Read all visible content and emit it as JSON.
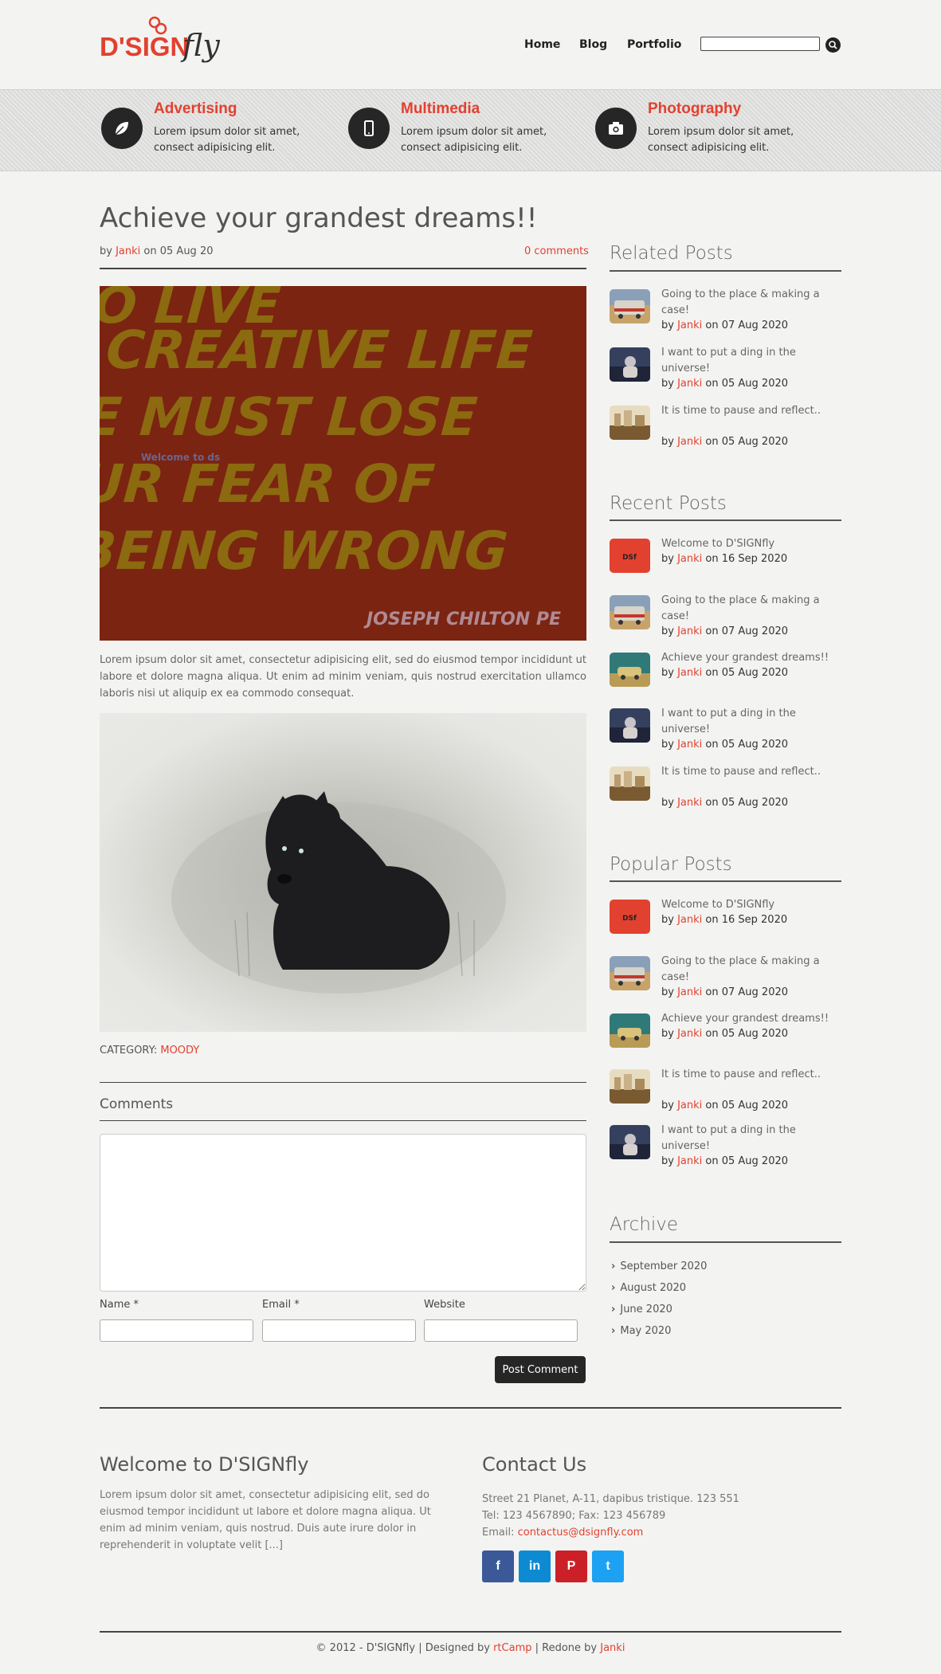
{
  "header": {
    "logo": {
      "part1": "D'SIGN",
      "part2": "fly"
    },
    "nav": [
      "Home",
      "Blog",
      "Portfolio"
    ],
    "search_placeholder": ""
  },
  "features": [
    {
      "icon": "leaf-icon",
      "title": "Advertising",
      "text": "Lorem ipsum dolor sit amet, consect adipisicing elit."
    },
    {
      "icon": "phone-icon",
      "title": "Multimedia",
      "text": "Lorem ipsum dolor sit amet, consect adipisicing elit."
    },
    {
      "icon": "camera-icon",
      "title": "Photography",
      "text": "Lorem ipsum dolor sit amet, consect adipisicing elit."
    }
  ],
  "post": {
    "title": "Achieve your grandest dreams!!",
    "by": "by",
    "author": "Janki",
    "date": "on 05 Aug 20",
    "comments_link": "0 comments",
    "image_quote": [
      "O LIVE",
      "CREATIVE LIFE",
      "E MUST LOSE",
      "UR FEAR OF",
      "BEING WRONG"
    ],
    "image_credit": "JOSEPH CHILTON PE",
    "image_overlay": "Welcome to ds",
    "body": "Lorem ipsum dolor sit amet, consectetur adipisicing elit, sed do eiusmod tempor incididunt ut labore et dolore magna aliqua. Ut enim ad minim veniam, quis nostrud exercitation ullamco laboris nisi ut aliquip ex ea commodo consequat.",
    "category_label": "CATEGORY:",
    "category": "MOODY"
  },
  "comments": {
    "title": "Comments",
    "name_label": "Name *",
    "email_label": "Email *",
    "website_label": "Website",
    "submit": "Post Comment"
  },
  "sidebar": {
    "related": {
      "title": "Related Posts",
      "items": [
        {
          "thumb": "bus",
          "title": "Going to the place & making a case!",
          "author": "Janki",
          "date": "on 07 Aug 2020"
        },
        {
          "thumb": "person",
          "title": "I want to put a ding in the universe!",
          "author": "Janki",
          "date": "on 05 Aug 2020"
        },
        {
          "thumb": "city",
          "title": "It is time to pause and reflect..",
          "author": "Janki",
          "date": "on 05 Aug 2020"
        }
      ]
    },
    "recent": {
      "title": "Recent Posts",
      "items": [
        {
          "thumb": "red",
          "title": "Welcome to D'SIGNfly",
          "author": "Janki",
          "date": "on 16 Sep 2020"
        },
        {
          "thumb": "bus",
          "title": "Going to the place & making a case!",
          "author": "Janki",
          "date": "on 07 Aug 2020"
        },
        {
          "thumb": "car",
          "title": "Achieve your grandest dreams!!",
          "author": "Janki",
          "date": "on 05 Aug 2020"
        },
        {
          "thumb": "person",
          "title": "I want to put a ding in the universe!",
          "author": "Janki",
          "date": "on 05 Aug 2020"
        },
        {
          "thumb": "city",
          "title": "It is time to pause and reflect..",
          "author": "Janki",
          "date": "on 05 Aug 2020"
        }
      ]
    },
    "popular": {
      "title": "Popular Posts",
      "items": [
        {
          "thumb": "red",
          "title": "Welcome to D'SIGNfly",
          "author": "Janki",
          "date": "on 16 Sep 2020"
        },
        {
          "thumb": "bus",
          "title": "Going to the place & making a case!",
          "author": "Janki",
          "date": "on 07 Aug 2020"
        },
        {
          "thumb": "car",
          "title": "Achieve your grandest dreams!!",
          "author": "Janki",
          "date": "on 05 Aug 2020"
        },
        {
          "thumb": "city",
          "title": "It is time to pause and reflect..",
          "author": "Janki",
          "date": "on 05 Aug 2020"
        },
        {
          "thumb": "person",
          "title": "I want to put a ding in the universe!",
          "author": "Janki",
          "date": "on 05 Aug 2020"
        }
      ]
    },
    "archive": {
      "title": "Archive",
      "items": [
        "September 2020",
        "August 2020",
        "June 2020",
        "May 2020"
      ]
    }
  },
  "footer": {
    "welcome_title": "Welcome to D'SIGNfly",
    "welcome_text": "Lorem ipsum dolor sit amet, consectetur adipisicing elit, sed do eiusmod tempor incididunt ut labore et dolore magna aliqua. Ut enim ad minim veniam, quis nostrud. Duis aute irure dolor in reprehenderit in voluptate velit [...]",
    "contact_title": "Contact Us",
    "address": "Street 21 Planet, A-11, dapibus tristique. 123 551",
    "phone": "Tel: 123 4567890; Fax: 123 456789",
    "email_label": "Email:",
    "email": "contactus@dsignfly.com",
    "social": [
      {
        "icon": "facebook-icon",
        "glyph": "f",
        "color": "#3b5998"
      },
      {
        "icon": "linkedin-icon",
        "glyph": "in",
        "color": "#0e8ad3"
      },
      {
        "icon": "pinterest-icon",
        "glyph": "P",
        "color": "#cb2027"
      },
      {
        "icon": "twitter-icon",
        "glyph": "t",
        "color": "#1da1f2"
      }
    ],
    "copyright_prefix": "© 2012 - D'SIGNfly | Designed by",
    "designer": "rtCamp",
    "redone_prefix": "| Redone by",
    "redone_by": "Janki"
  },
  "colors": {
    "accent": "#e2412f",
    "dark": "#262626"
  }
}
